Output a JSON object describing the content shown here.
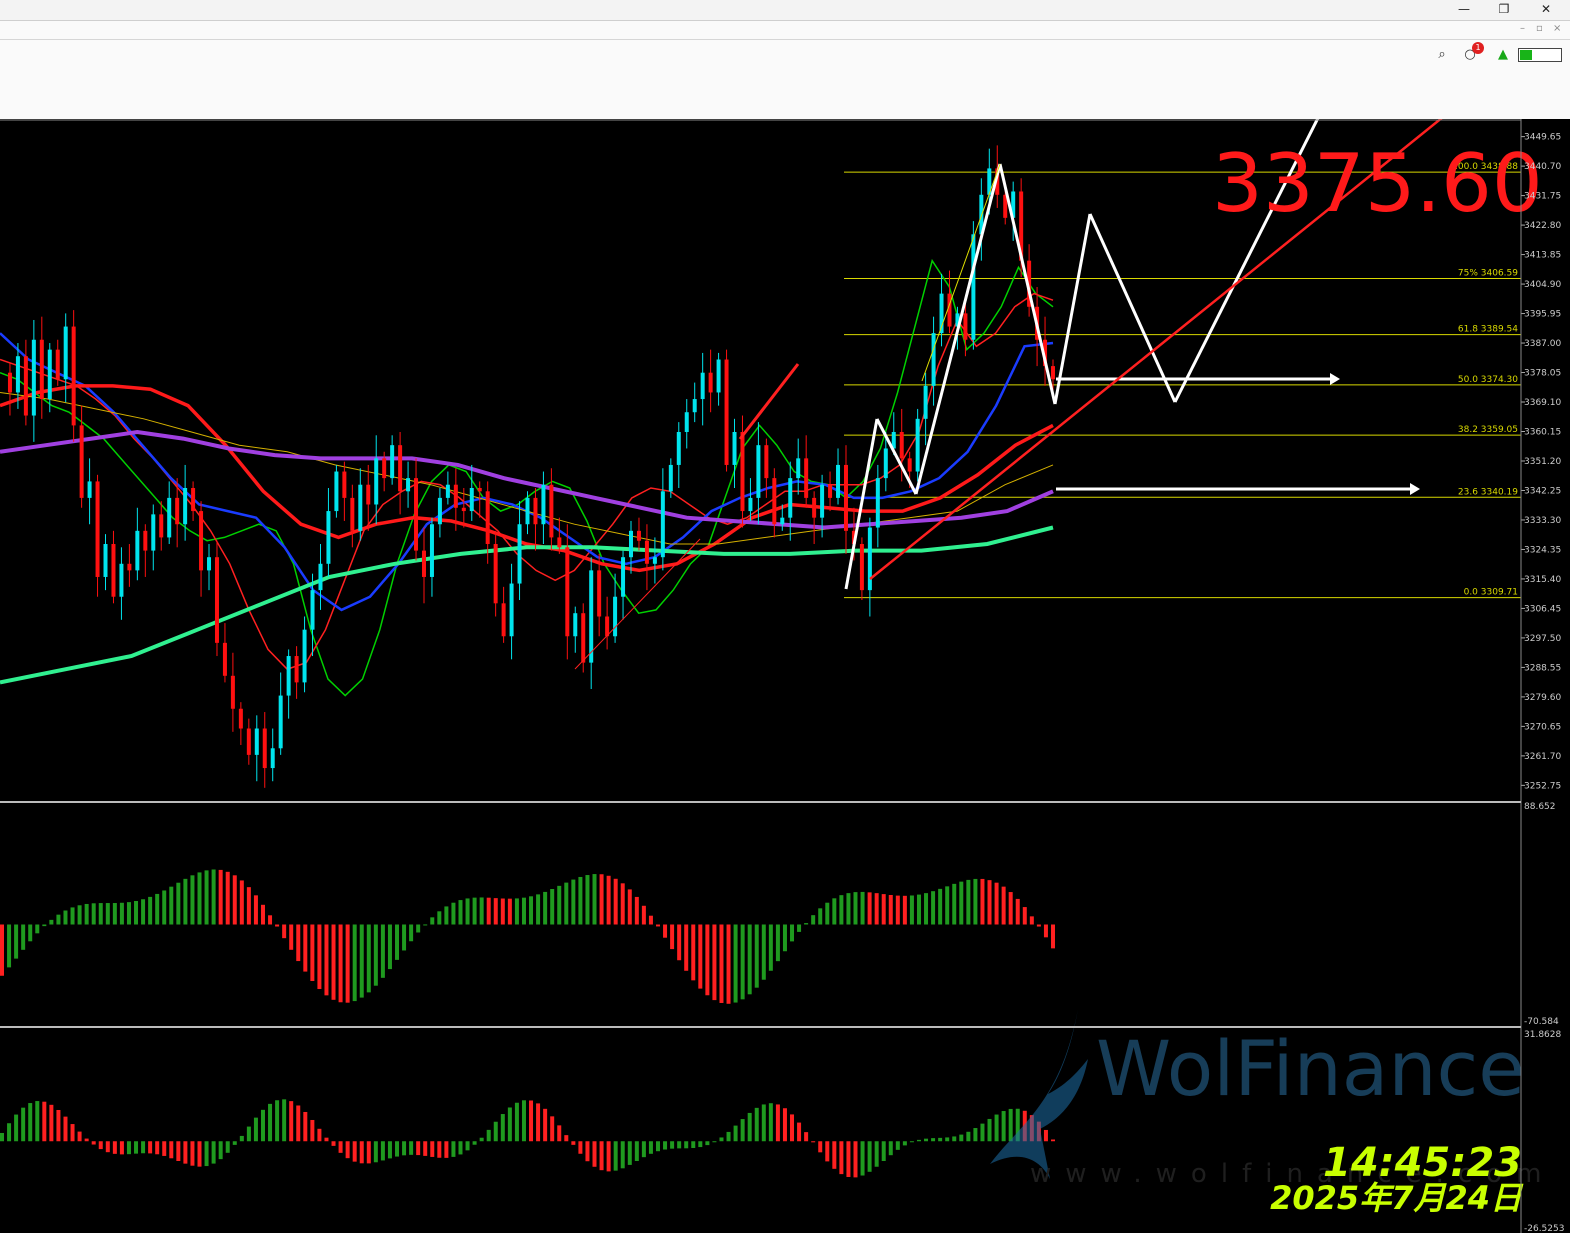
{
  "window": {
    "minimize": "—",
    "restore": "❐",
    "close": "✕",
    "sub_controls": [
      "–",
      "▫",
      "×"
    ]
  },
  "toolbar": {
    "notification_count": "1",
    "battery_level": 0.3
  },
  "colors": {
    "background": "#000000",
    "bull": "#00e5ee",
    "bear": "#ff1010",
    "ma_green": "#00d000",
    "ma_red_thin": "#ff2020",
    "ma_blue": "#1a3cff",
    "ma_red_thick": "#ff1a1a",
    "ma_yellow": "#d4b000",
    "ma_purple": "#a040e0",
    "ma_springgreen": "#30f090",
    "fib": "#d8d800",
    "hist_up": "#1f9a1f",
    "hist_down": "#ff2020"
  },
  "chart_data": {
    "type": "candlestick",
    "price_label": "3375.60",
    "ylim": [
      3248,
      3455
    ],
    "y_ticks": [
      "3449.65",
      "3440.70",
      "3431.75",
      "3422.80",
      "3413.85",
      "3404.90",
      "3395.95",
      "3387.00",
      "3378.05",
      "3369.10",
      "3360.15",
      "3351.20",
      "3342.25",
      "3333.30",
      "3324.35",
      "3315.40",
      "3306.45",
      "3297.50",
      "3288.55",
      "3279.60",
      "3270.65",
      "3261.70",
      "3252.75"
    ],
    "fibonacci": [
      {
        "ratio": "100.0",
        "price": "3438.88"
      },
      {
        "ratio": "75%",
        "price": "3406.59"
      },
      {
        "ratio": "61.8",
        "price": "3389.54"
      },
      {
        "ratio": "50.0",
        "price": "3374.30"
      },
      {
        "ratio": "38.2",
        "price": "3359.05"
      },
      {
        "ratio": "23.6",
        "price": "3340.19"
      },
      {
        "ratio": "0.0",
        "price": "3309.71"
      }
    ],
    "closes": [
      3378,
      3372,
      3383,
      3365,
      3388,
      3370,
      3385,
      3376,
      3392,
      3362,
      3340,
      3345,
      3316,
      3326,
      3310,
      3320,
      3318,
      3330,
      3324,
      3335,
      3328,
      3340,
      3332,
      3343,
      3336,
      3318,
      3322,
      3296,
      3286,
      3276,
      3270,
      3262,
      3270,
      3258,
      3264,
      3280,
      3292,
      3284,
      3300,
      3312,
      3320,
      3336,
      3348,
      3340,
      3330,
      3344,
      3338,
      3352,
      3346,
      3356,
      3342,
      3346,
      3324,
      3316,
      3332,
      3340,
      3344,
      3337,
      3336,
      3343,
      3342,
      3326,
      3308,
      3298,
      3314,
      3332,
      3340,
      3332,
      3344,
      3328,
      3325,
      3298,
      3305,
      3290,
      3318,
      3304,
      3298,
      3310,
      3322,
      3330,
      3327,
      3320,
      3322,
      3342,
      3350,
      3360,
      3366,
      3370,
      3378,
      3372,
      3382,
      3350,
      3360,
      3336,
      3340,
      3356,
      3346,
      3332,
      3334,
      3346,
      3352,
      3340,
      3334,
      3344,
      3340,
      3350,
      3330,
      3326,
      3312,
      3331,
      3346,
      3355,
      3360,
      3352,
      3348,
      3364,
      3374,
      3390,
      3402,
      3392,
      3396,
      3388,
      3420,
      3432,
      3440,
      3432,
      3425,
      3433,
      3412,
      3398,
      3388,
      3380,
      3376
    ],
    "ma_lines": [
      {
        "color": "ma_green",
        "values": [
          3378,
          3376,
          3372,
          3368,
          3366,
          3362,
          3358,
          3352,
          3346,
          3340,
          3334,
          3330,
          3327,
          3328,
          3330,
          3332,
          3330,
          3320,
          3300,
          3285,
          3280,
          3285,
          3300,
          3320,
          3335,
          3345,
          3350,
          3348,
          3340,
          3336,
          3338,
          3342,
          3345,
          3343,
          3333,
          3320,
          3312,
          3305,
          3306,
          3312,
          3320,
          3325,
          3340,
          3355,
          3362,
          3356,
          3348,
          3345,
          3344,
          3340,
          3345,
          3355,
          3372,
          3392,
          3412,
          3404,
          3385,
          3390,
          3398,
          3410,
          3402,
          3398
        ]
      },
      {
        "color": "ma_red_thin",
        "values": [
          3382,
          3380,
          3378,
          3376,
          3374,
          3370,
          3365,
          3358,
          3352,
          3345,
          3338,
          3330,
          3320,
          3306,
          3294,
          3288,
          3290,
          3300,
          3315,
          3330,
          3338,
          3342,
          3345,
          3344,
          3340,
          3335,
          3330,
          3323,
          3318,
          3315,
          3318,
          3325,
          3332,
          3340,
          3343,
          3342,
          3338,
          3334,
          3332,
          3334,
          3338,
          3342,
          3342,
          3344,
          3344,
          3344,
          3346,
          3350,
          3360,
          3380,
          3394,
          3386,
          3390,
          3398,
          3402,
          3400
        ]
      },
      {
        "color": "ma_blue",
        "values": [
          3390,
          3382,
          3378,
          3374,
          3366,
          3356,
          3346,
          3338,
          3336,
          3334,
          3325,
          3312,
          3306,
          3310,
          3320,
          3332,
          3338,
          3340,
          3338,
          3334,
          3328,
          3322,
          3320,
          3322,
          3328,
          3336,
          3340,
          3343,
          3345,
          3344,
          3340,
          3340,
          3342,
          3346,
          3354,
          3368,
          3386,
          3387
        ]
      },
      {
        "color": "ma_red_thick",
        "values": [
          3368,
          3372,
          3374,
          3374,
          3373,
          3368,
          3356,
          3342,
          3332,
          3328,
          3332,
          3334,
          3333,
          3330,
          3326,
          3324,
          3320,
          3318,
          3320,
          3326,
          3334,
          3338,
          3337,
          3336,
          3336,
          3340,
          3347,
          3356,
          3362
        ]
      },
      {
        "color": "ma_yellow",
        "values": [
          3372,
          3370,
          3367,
          3364,
          3360,
          3356,
          3354,
          3350,
          3347,
          3344,
          3340,
          3336,
          3332,
          3329,
          3326,
          3326,
          3328,
          3330,
          3332,
          3334,
          3336,
          3344,
          3350
        ]
      },
      {
        "color": "ma_purple",
        "values": [
          3354,
          3356,
          3358,
          3360,
          3358,
          3355,
          3353,
          3352,
          3352,
          3352,
          3350,
          3346,
          3343,
          3340,
          3337,
          3334,
          3333,
          3332,
          3331,
          3332,
          3333,
          3334,
          3336,
          3342
        ]
      },
      {
        "color": "ma_springgreen",
        "values": [
          3284,
          3288,
          3292,
          3300,
          3308,
          3316,
          3320,
          3323,
          3325,
          3325,
          3324,
          3323,
          3323,
          3324,
          3324,
          3326,
          3331
        ]
      }
    ],
    "osc1": {
      "ylim": [
        -70.584,
        88.652
      ],
      "top_label": "88.652",
      "bottom_label": "-70.584"
    },
    "osc2": {
      "ylim": [
        -26.5253,
        31.8628
      ],
      "top_label": "31.8628",
      "bottom_label": "-26.5253"
    }
  },
  "watermark": {
    "brand": "WolFinance",
    "url": "www.wolfinance.com"
  },
  "clock": {
    "time": "14:45:23",
    "date": "2025年7月24日"
  }
}
